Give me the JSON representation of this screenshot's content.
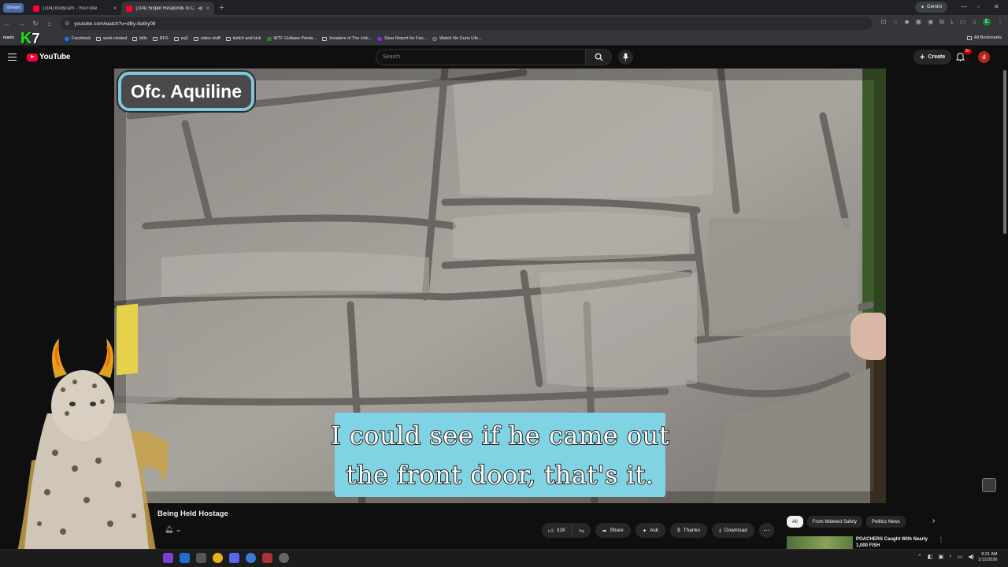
{
  "browser": {
    "stream_tab": "stream",
    "tabs": [
      {
        "title": "(104) bodycam - YouTube"
      },
      {
        "title": "(104) Sniper Responds to C"
      }
    ],
    "new_tab": "+",
    "gemini": "Gemini",
    "url": "youtube.com/watch?v=dBy-8a6Iy08",
    "bookmarks": [
      "Facebook",
      "work related",
      "bills",
      "RFS",
      "eq2",
      "video stuff",
      "twitch and kick",
      "WTF Outlaws Points...",
      "Invaders of The Unk...",
      "Gear Report for Fan...",
      "Watch No Guns Life..."
    ],
    "all_bookmarks": "All Bookmarks",
    "profile_initial": "E"
  },
  "stream_overlay": {
    "manic": "manic",
    "k": "K",
    "seven": "7"
  },
  "youtube": {
    "logo": "YouTube",
    "search_placeholder": "Search",
    "create": "Create",
    "notif_count": "9+",
    "avatar_initial": "d"
  },
  "video": {
    "name_tag": "Ofc. Aquiline",
    "caption_line1": "I could see if he came out",
    "caption_line2": "the front door, that's it.",
    "title_partial": "Being Held Hostage"
  },
  "actions": {
    "likes": "31K",
    "share": "Share",
    "ask": "Ask",
    "thanks": "Thanks",
    "download": "Download",
    "more": "⋯"
  },
  "chips": [
    "All",
    "From Midwest Safety",
    "Politics News"
  ],
  "recommendation": {
    "title": "POACHERS Caught With Nearly 1,000 FISH"
  },
  "taskbar": {
    "time": "9:21 AM",
    "date": "1/12/2026"
  },
  "colors": {
    "youtube_red": "#ff0033",
    "caption_bg": "#7fd3e3",
    "nametag_border": "#7ec8de",
    "k7_green": "#22e322"
  }
}
